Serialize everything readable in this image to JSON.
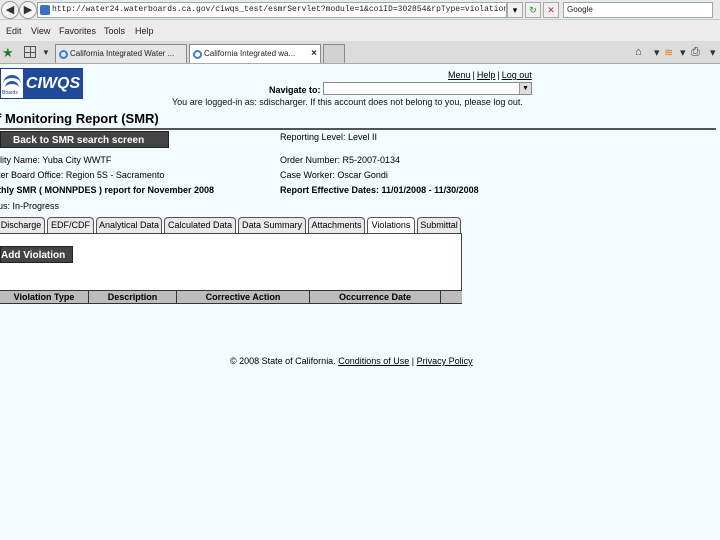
{
  "browser": {
    "url": "http://water24.waterboards.ca.gov/ciwqs_test/esmrServlet?module=1&coiID=302854&rpType=violation&action=summary&",
    "search_value": "Google",
    "menu": [
      "Edit",
      "View",
      "Favorites",
      "Tools",
      "Help"
    ],
    "tabs": [
      {
        "label": "California Integrated Water ...",
        "active": false
      },
      {
        "label": "California Integrated wa...",
        "active": true
      }
    ]
  },
  "header": {
    "logo_text": "CIWQS",
    "logo_sub": "Boards",
    "links": [
      "Menu",
      "Help",
      "Log out"
    ],
    "navigate_label": "Navigate to:",
    "navigate_value": "",
    "notice": "You are logged-in as: sdischarger. If this account does not belong to you, please log out."
  },
  "report": {
    "title": "f Monitoring Report (SMR)",
    "back_button": "Back to SMR search screen",
    "left_fields": [
      "ility Name: Yuba City WWTF",
      "ter Board Office: Region 5S - Sacramento",
      "thly SMR ( MONNPDES ) report for November 2008",
      "us: In-Progress"
    ],
    "right_fields": [
      "Reporting Level: Level II",
      "Order Number: R5-2007-0134",
      "Case Worker: Oscar Gondi",
      "Report Effective Dates: 11/01/2008 - 11/30/2008"
    ]
  },
  "smr_tabs": [
    {
      "label": "Discharge",
      "active": false
    },
    {
      "label": "EDF/CDF",
      "active": false
    },
    {
      "label": "Analytical Data",
      "active": false
    },
    {
      "label": "Calculated Data",
      "active": false
    },
    {
      "label": "Data Summary",
      "active": false
    },
    {
      "label": "Attachments",
      "active": false
    },
    {
      "label": "Violations",
      "active": true
    },
    {
      "label": "Submittal",
      "active": false
    }
  ],
  "violations": {
    "add_button": "Add Violation",
    "columns": [
      "Violation Type",
      "Description",
      "Corrective Action",
      "Occurrence Date"
    ]
  },
  "footer": {
    "copyright": "© 2008 State of California.",
    "links": [
      "Conditions of Use",
      "Privacy Policy"
    ]
  }
}
